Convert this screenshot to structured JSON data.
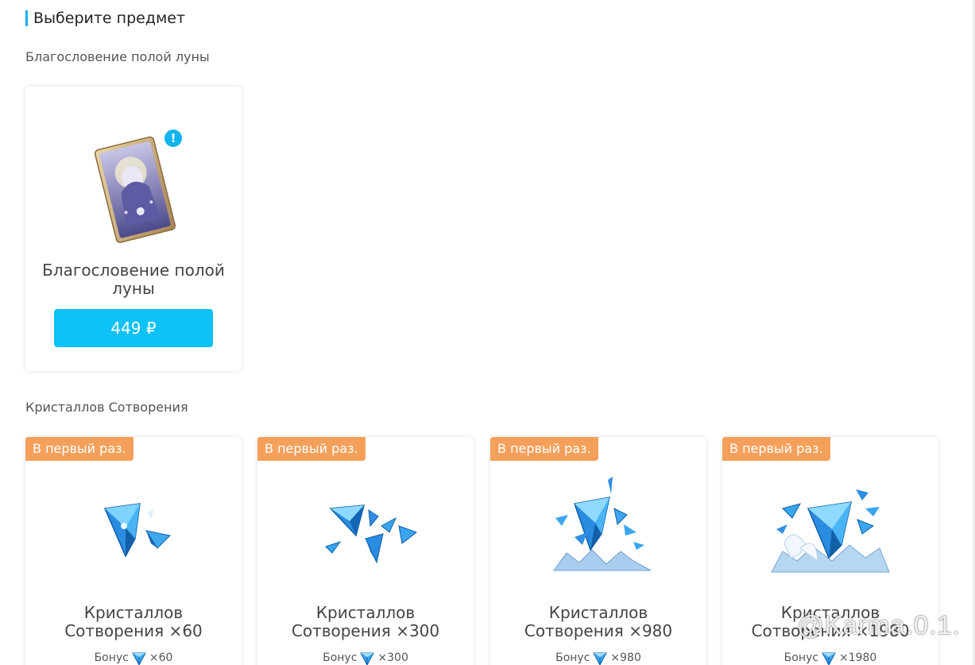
{
  "header": {
    "title": "Выберите предмет",
    "accent_color": "#1ab0ee"
  },
  "sections": {
    "moon": {
      "label": "Благословение полой луны",
      "card": {
        "name": "Благословение полой луны",
        "price": "449 ₽",
        "icon": "welkin-moon-card-icon",
        "alert_icon": "exclamation-icon"
      }
    },
    "crystals": {
      "label": "Кристаллов Сотворения",
      "cards": [
        {
          "badge": "В первый раз.",
          "name": "Кристаллов Сотворения ×60",
          "bonus_label": "Бонус",
          "bonus_amount": "×60"
        },
        {
          "badge": "В первый раз.",
          "name": "Кристаллов Сотворения ×300",
          "bonus_label": "Бонус",
          "bonus_amount": "×300"
        },
        {
          "badge": "В первый раз.",
          "name": "Кристаллов Сотворения ×980",
          "bonus_label": "Бонус",
          "bonus_amount": "×980"
        },
        {
          "badge": "В первый раз.",
          "name": "Кристаллов Сотворения ×1980",
          "bonus_label": "Бонус",
          "bonus_amount": "×1980"
        }
      ]
    }
  },
  "colors": {
    "price_button": "#0ec1f7",
    "badge": "#f5a05a"
  },
  "watermark": "@Karma.0.1."
}
